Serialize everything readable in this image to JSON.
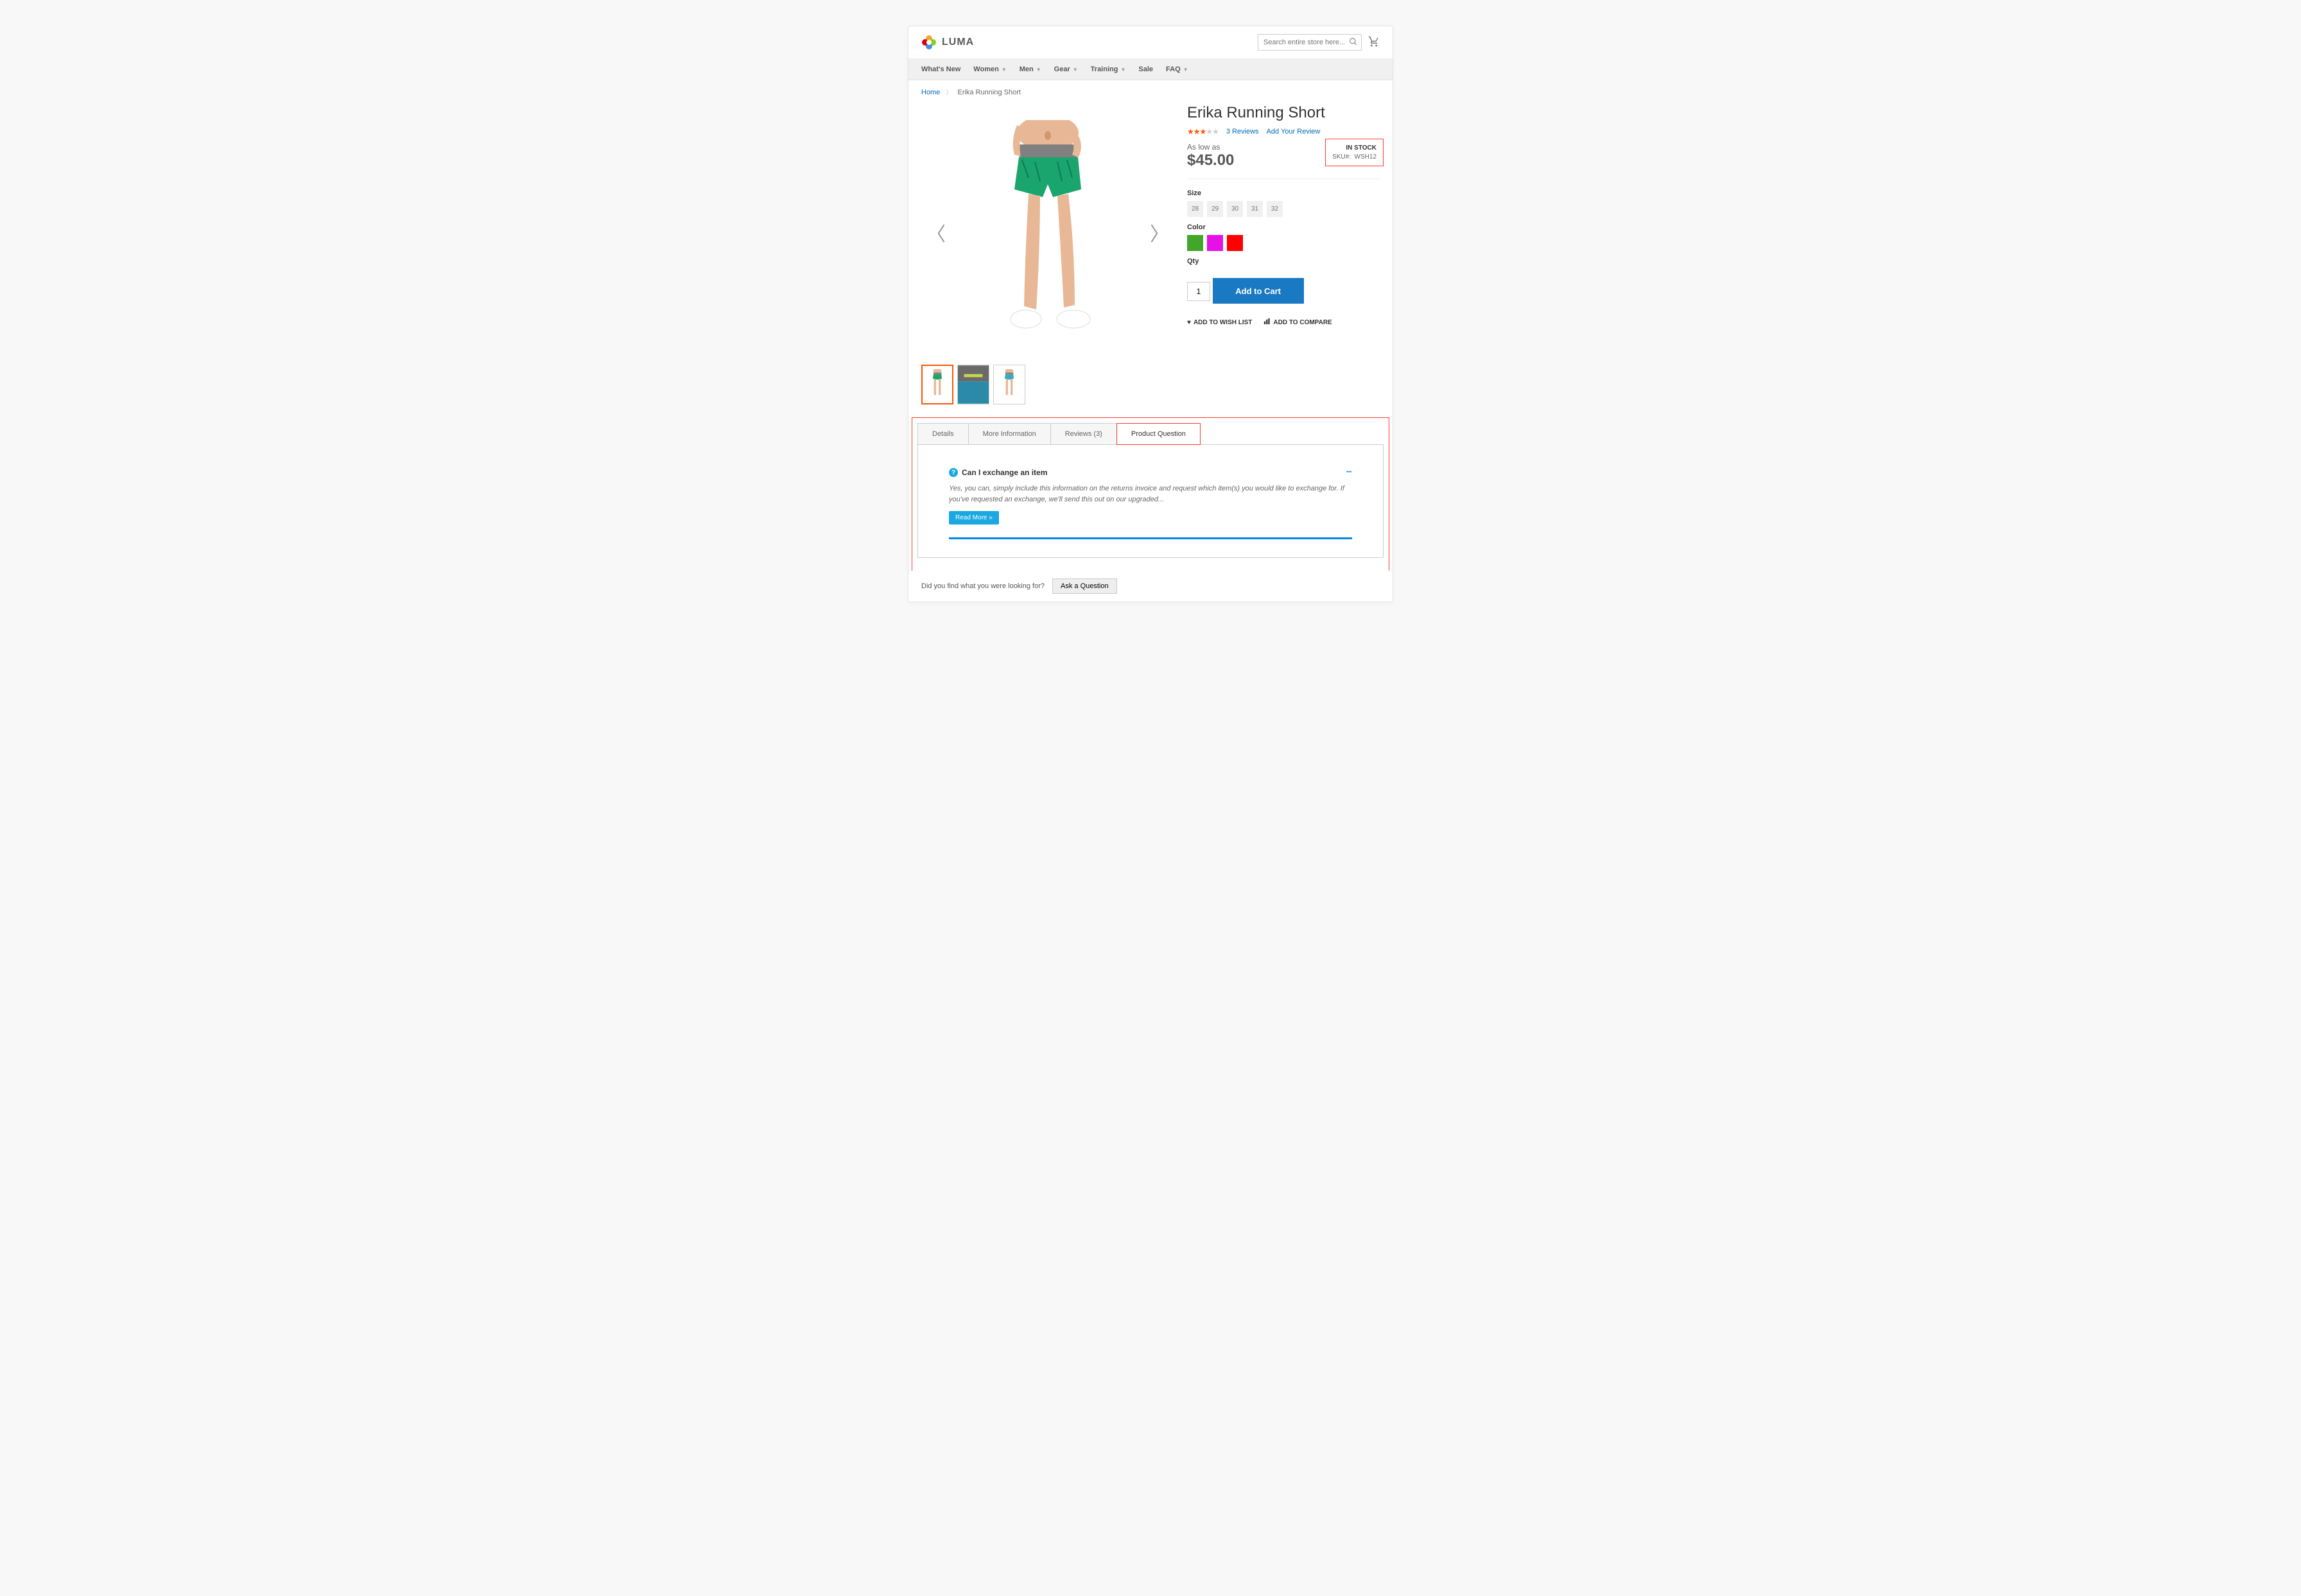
{
  "logo_text": "LUMA",
  "search_placeholder": "Search entire store here...",
  "nav": [
    {
      "label": "What's New",
      "has_chev": false
    },
    {
      "label": "Women",
      "has_chev": true
    },
    {
      "label": "Men",
      "has_chev": true
    },
    {
      "label": "Gear",
      "has_chev": true
    },
    {
      "label": "Training",
      "has_chev": true
    },
    {
      "label": "Sale",
      "has_chev": false
    },
    {
      "label": "FAQ",
      "has_chev": true
    }
  ],
  "crumbs": {
    "home": "Home",
    "current": "Erika Running Short"
  },
  "product": {
    "title": "Erika Running Short",
    "rating_filled": 3,
    "rating_total": 5,
    "reviews_link": "3  Reviews",
    "add_review": "Add Your Review",
    "as_low_as": "As low as",
    "price": "$45.00",
    "stock_status": "IN STOCK",
    "sku_label": "SKU#:",
    "sku": "WSH12",
    "size_label": "Size",
    "sizes": [
      "28",
      "29",
      "30",
      "31",
      "32"
    ],
    "color_label": "Color",
    "colors": [
      "#42a62a",
      "#e512e5",
      "#ff0000"
    ],
    "qty_label": "Qty",
    "qty_value": "1",
    "add_to_cart": "Add to Cart",
    "wishlist": "ADD TO WISH LIST",
    "compare": "ADD TO COMPARE"
  },
  "tabs": [
    {
      "label": "Details",
      "active": false
    },
    {
      "label": "More Information",
      "active": false
    },
    {
      "label": "Reviews (3)",
      "active": false
    },
    {
      "label": "Product Question",
      "active": true
    }
  ],
  "question": {
    "title": "Can I exchange an item",
    "answer": "Yes, you can, simply include this information on the returns invoice and request which item(s) you would like to exchange for. If you've requested an exchange, we'll send this out on our upgraded...",
    "read_more": "Read More »"
  },
  "ask": {
    "prompt": "Did you find what you were looking for?",
    "button": "Ask a Question"
  }
}
